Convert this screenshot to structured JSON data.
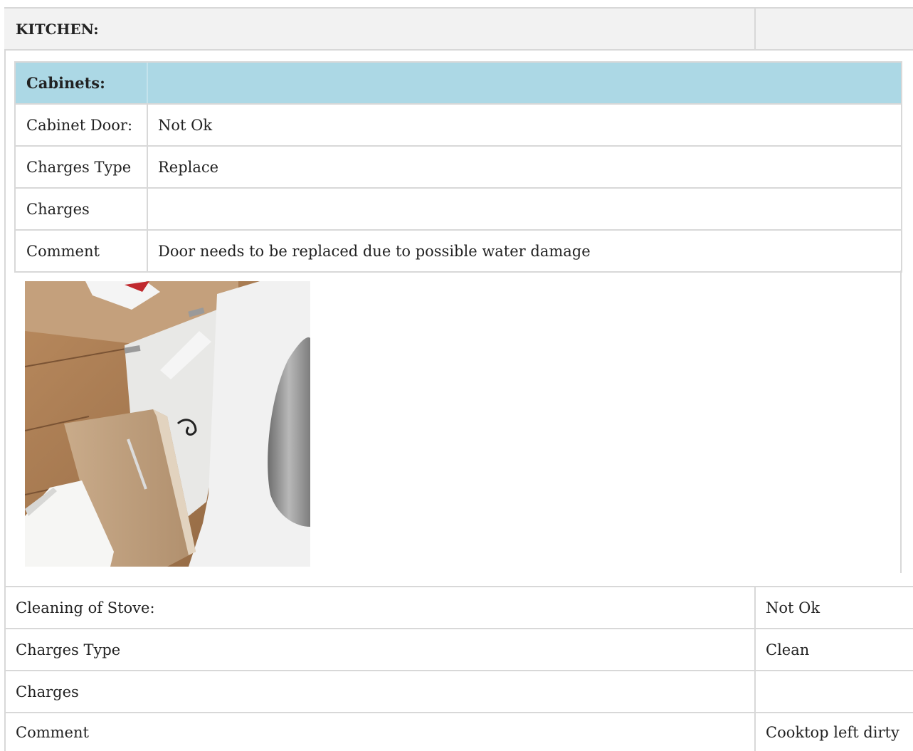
{
  "kitchen": {
    "title": "KITCHEN:",
    "value": ""
  },
  "cabinets": {
    "title": "Cabinets:",
    "rows": [
      {
        "label": "Cabinet Door:",
        "value": "Not Ok"
      },
      {
        "label": "Charges Type",
        "value": "Replace"
      },
      {
        "label": "Charges",
        "value": ""
      },
      {
        "label": "Comment",
        "value": "Door needs to be replaced due to possible water damage"
      }
    ]
  },
  "stove": {
    "rows": [
      {
        "label": "Cleaning of Stove:",
        "value": "Not Ok"
      },
      {
        "label": "Charges Type",
        "value": "Clean"
      },
      {
        "label": "Charges",
        "value": ""
      },
      {
        "label": "Comment",
        "value": "Cooktop left dirty"
      }
    ]
  },
  "colors": {
    "header_bg": "#f2f2f2",
    "cabinets_header_bg": "#acd8e5",
    "border": "#d8d8d8"
  }
}
